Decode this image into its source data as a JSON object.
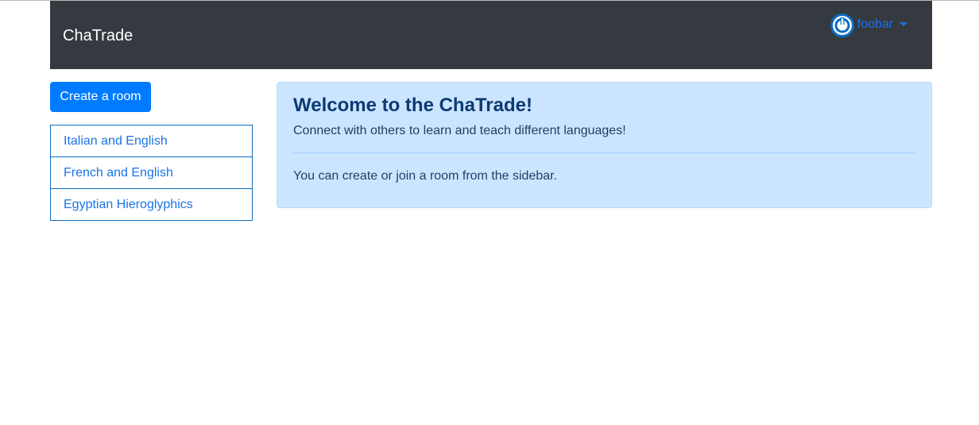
{
  "navbar": {
    "brand": "ChaTrade",
    "user": {
      "name": "foobar",
      "avatar_icon": "power-icon"
    }
  },
  "sidebar": {
    "create_button_label": "Create a room",
    "rooms": [
      {
        "label": "Italian and English"
      },
      {
        "label": "French and English"
      },
      {
        "label": "Egyptian Hieroglyphics"
      }
    ]
  },
  "welcome": {
    "title": "Welcome to the ChaTrade!",
    "subtitle": "Connect with others to learn and teach different languages!",
    "note": "You can create or join a room from the sidebar."
  },
  "colors": {
    "navbar_bg": "#343a40",
    "primary": "#007bff",
    "link": "#1a73e8",
    "alert_bg": "#cce5ff",
    "alert_text": "#004085"
  }
}
